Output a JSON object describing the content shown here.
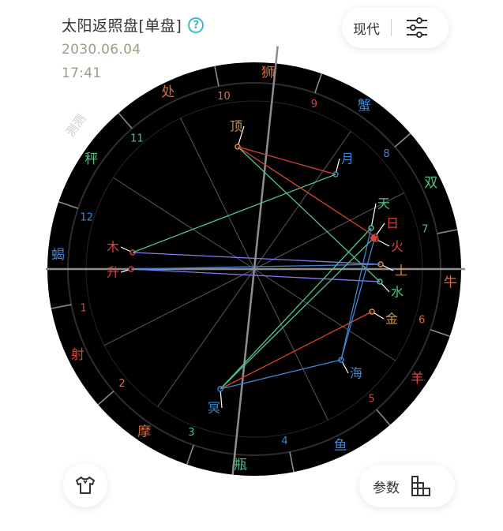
{
  "header": {
    "title": "太阳返照盘[单盘]",
    "date": "2030.06.04",
    "time": "17:41"
  },
  "top_controls": {
    "mode_label": "现代",
    "settings_icon": "sliders-icon",
    "help_icon": "question-circle-icon"
  },
  "bottom_controls": {
    "params_label": "参数",
    "params_icon": "bar-chart-icon",
    "left_icon": "shirt-icon"
  },
  "watermark": "测测",
  "wheel": {
    "signs": [
      {
        "name": "处",
        "color": "#d2704a"
      },
      {
        "name": "狮",
        "color": "#d2704a"
      },
      {
        "name": "蟹",
        "color": "#3f86d4"
      },
      {
        "name": "双",
        "color": "#4fc486"
      },
      {
        "name": "牛",
        "color": "#d2704a"
      },
      {
        "name": "羊",
        "color": "#d8453a"
      },
      {
        "name": "鱼",
        "color": "#3f86d4"
      },
      {
        "name": "瓶",
        "color": "#4fc486"
      },
      {
        "name": "摩",
        "color": "#d2704a"
      },
      {
        "name": "射",
        "color": "#d8453a"
      },
      {
        "name": "蝎",
        "color": "#3f86d4"
      },
      {
        "name": "秤",
        "color": "#4fc486"
      }
    ],
    "houses": [
      {
        "num": "1",
        "color": "#d8453a"
      },
      {
        "num": "2",
        "color": "#d2704a"
      },
      {
        "num": "3",
        "color": "#4fc486"
      },
      {
        "num": "4",
        "color": "#3f86d4"
      },
      {
        "num": "5",
        "color": "#d8453a"
      },
      {
        "num": "6",
        "color": "#d2704a"
      },
      {
        "num": "7",
        "color": "#4fc486"
      },
      {
        "num": "8",
        "color": "#3f86d4"
      },
      {
        "num": "9",
        "color": "#d8453a"
      },
      {
        "num": "10",
        "color": "#d2704a"
      },
      {
        "num": "11",
        "color": "#4fc486"
      },
      {
        "num": "12",
        "color": "#3f86d4"
      }
    ],
    "planets": [
      {
        "name": "顶",
        "color": "#d2904a"
      },
      {
        "name": "月",
        "color": "#3f86d4"
      },
      {
        "name": "天",
        "color": "#4fc486"
      },
      {
        "name": "日",
        "color": "#d8453a"
      },
      {
        "name": "火",
        "color": "#d8453a"
      },
      {
        "name": "土",
        "color": "#d2904a"
      },
      {
        "name": "水",
        "color": "#4fc486"
      },
      {
        "name": "金",
        "color": "#d2904a"
      },
      {
        "name": "海",
        "color": "#3f86d4"
      },
      {
        "name": "冥",
        "color": "#3f86d4"
      },
      {
        "name": "木",
        "color": "#d8453a"
      },
      {
        "name": "升",
        "color": "#d8453a"
      }
    ],
    "aspect_colors": {
      "green": "#4fc486",
      "red": "#d8453a",
      "blue": "#3f86d4",
      "purple": "#8a7cf0"
    }
  }
}
